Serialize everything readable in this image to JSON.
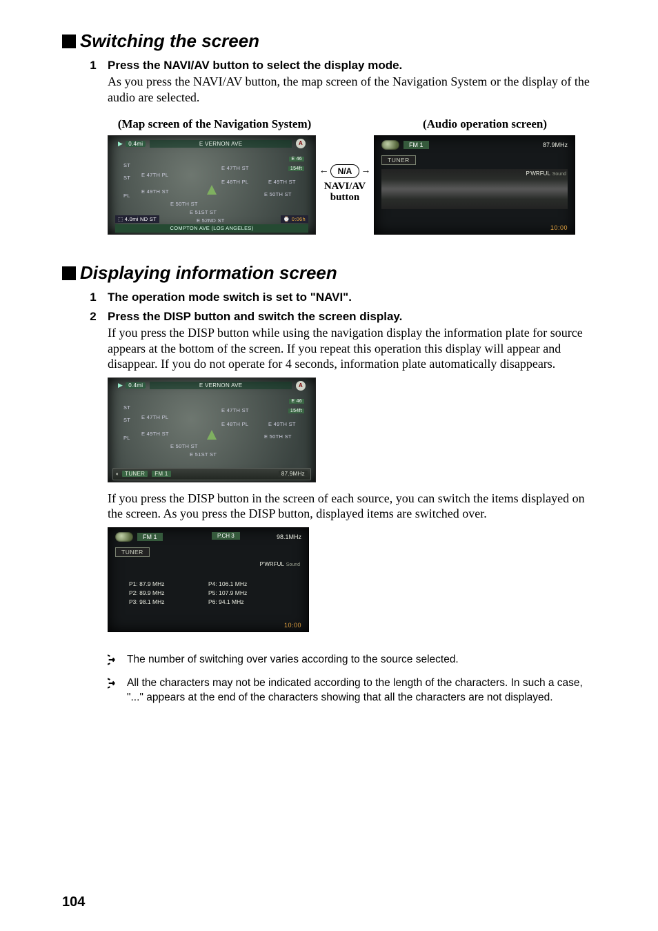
{
  "pageNumber": "104",
  "section1": {
    "title": "Switching the screen",
    "step1": {
      "num": "1",
      "title": "Press the NAVI/AV button to select the display mode.",
      "text": "As you press the NAVI/AV button, the map screen of the Navigation System or the display of the audio are selected."
    },
    "captionLeft": "(Map screen of the Navigation System)",
    "captionRight": "(Audio operation screen)",
    "naviav": {
      "pill": "N/A",
      "label1": "NAVI/AV",
      "label2": "button"
    },
    "navFig": {
      "scale": "0.4mi",
      "title": "E VERNON AVE",
      "gps": "A",
      "streets": {
        "a": "E 47TH PL",
        "b": "E 49TH ST",
        "c": "E 47TH ST",
        "d": "E 48TH PL",
        "e": "E 49TH ST",
        "f": "E 50TH ST",
        "g": "E 50TH ST",
        "h": "E 51ST ST",
        "i": "E 52ND ST",
        "chip1": "154ft",
        "chip2": "E 46"
      },
      "dist": "4.0mi ND ST",
      "time": "0:06h",
      "bottom": "COMPTON AVE (LOS ANGELES)"
    },
    "audioFig": {
      "band": "FM 1",
      "freq": "87.9MHz",
      "tuner": "TUNER",
      "pw": "P'WRFUL",
      "pwSound": "Sound",
      "clock": "10:00"
    }
  },
  "section2": {
    "title": "Displaying information screen",
    "step1": {
      "num": "1",
      "title": "The operation mode switch is set to \"NAVI\"."
    },
    "step2": {
      "num": "2",
      "title": "Press the DISP button and switch the screen display.",
      "text": "If you press the DISP button while using the navigation display the information plate for source appears at the bottom of the screen. If you repeat this operation this display will appear and disappear. If you do not operate for 4 seconds, information plate automatically disappears."
    },
    "navFig2": {
      "scale": "0.4mi",
      "title": "E VERNON AVE",
      "gps": "A",
      "info": {
        "tuner": "TUNER",
        "band": "FM 1",
        "freq": "87.9MHz"
      }
    },
    "para": "If you press the DISP button in the screen of each source, you can switch the items displayed on the screen. As you press the DISP button, displayed items are switched over.",
    "audioFig2": {
      "band": "FM 1",
      "pch": "P.CH 3",
      "freq": "98.1MHz",
      "tuner": "TUNER",
      "pw": "P'WRFUL",
      "pwSound": "Sound",
      "presets": {
        "p1": "P1: 87.9 MHz",
        "p4": "P4: 106.1 MHz",
        "p2": "P2: 89.9 MHz",
        "p5": "P5: 107.9 MHz",
        "p3": "P3: 98.1 MHz",
        "p6": "P6: 94.1 MHz"
      },
      "clock": "10:00"
    },
    "note1": "The number of switching over varies according to the source selected.",
    "note2": "All the characters may not be indicated according to the length of the characters. In such a case, \"...\" appears at the end of the characters showing that all the characters are not displayed."
  }
}
